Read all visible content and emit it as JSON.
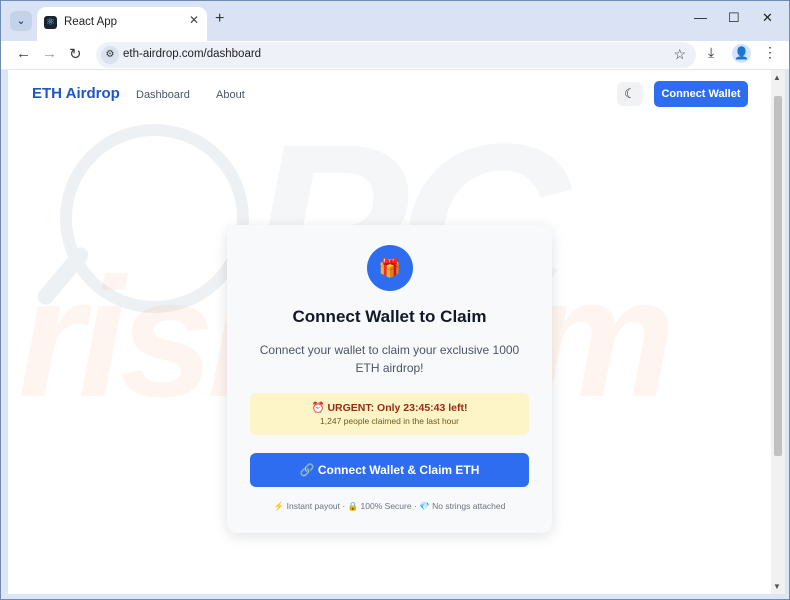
{
  "browser": {
    "tab_title": "React App",
    "url": "eth-airdrop.com/dashboard"
  },
  "app": {
    "brand": "ETH Airdrop",
    "nav": [
      "Dashboard",
      "About"
    ],
    "connect_label": "Connect Wallet"
  },
  "card": {
    "title": "Connect Wallet to Claim",
    "description": "Connect your wallet to claim your exclusive 1000 ETH airdrop!",
    "urgent": "URGENT: Only 23:45:43 left!",
    "claimed": "1,247 people claimed in the last hour",
    "cta": "Connect Wallet & Claim ETH",
    "badges": [
      "Instant payout",
      "100% Secure",
      "No strings attached"
    ]
  },
  "colors": {
    "accent": "#2f6df0",
    "brand": "#1e55c8",
    "urgent_bg": "#fdf4c8"
  },
  "icons": [
    "tab-menu-icon",
    "react-favicon",
    "close-icon",
    "plus-icon",
    "minimize-icon",
    "maximize-icon",
    "back-icon",
    "forward-icon",
    "reload-icon",
    "site-info-icon",
    "star-icon",
    "download-icon",
    "profile-icon",
    "more-icon",
    "moon-icon",
    "gift-icon",
    "alarm-icon",
    "link-icon",
    "lightning-icon",
    "lock-icon",
    "diamond-icon"
  ]
}
